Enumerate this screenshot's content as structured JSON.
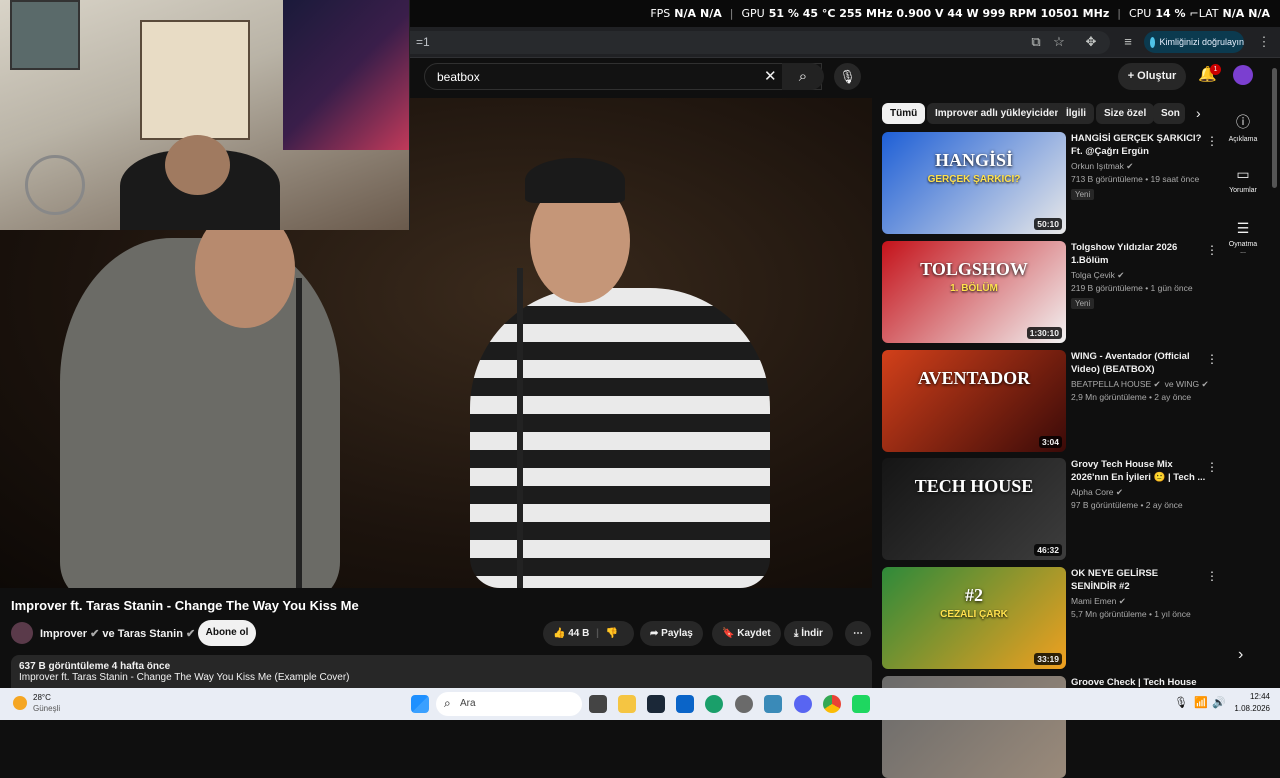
{
  "osd": {
    "fps_label": "FPS",
    "fps_val1": "N/A",
    "fps_val2": "N/A",
    "gpu_label": "GPU",
    "gpu_vals": "51 %  45 °C  255 MHz  0.900 V  44 W  999 RPM  10501 MHz",
    "cpu_label": "CPU",
    "cpu_vals": "14 %",
    "lat_label": "LAT",
    "lat_val1": "N/A",
    "lat_val2": "N/A"
  },
  "browser": {
    "url_fragment": "=1",
    "verify_label": "Kimliğinizi doğrulayın"
  },
  "header": {
    "search_value": "beatbox",
    "create_label": "Oluştur",
    "bell_badge": "1"
  },
  "video": {
    "title": "Improver ft. Taras Stanin - Change The Way You Kiss Me",
    "channel": "Improver",
    "channel_joiner": "ve Taras Stanin",
    "subscribe_label": "Abone ol",
    "like_count": "44 B",
    "share_label": "Paylaş",
    "save_label": "Kaydet",
    "download_label": "İndir",
    "views_line": "637 B görüntüleme  4 hafta önce",
    "desc_line": "Improver ft. Taras Stanin - Change The Way You Kiss Me (Example Cover)"
  },
  "chips": [
    "Tümü",
    "Improver adlı yükleyiciden",
    "İlgili",
    "Size özel",
    "Son"
  ],
  "side_actions": [
    {
      "icon": "info-icon",
      "label": "Açıklama"
    },
    {
      "icon": "comments-icon",
      "label": "Yorumlar"
    },
    {
      "icon": "playlist-icon",
      "label": "Oynatma ..."
    }
  ],
  "recommendations": [
    {
      "title": "HANGİSİ GERÇEK ŞARKICI? Ft. @Çağrı Ergün",
      "channel": "Orkun Işıtmak",
      "meta": "713 B görüntüleme • 19 saat önce",
      "badge": "Yeni",
      "duration": "50:10",
      "thumb_text": "HANGİSİ",
      "thumb_sub": "GERÇEK ŞARKICI?",
      "color1": "#1e5fd6",
      "color2": "#e8e8e8"
    },
    {
      "title": "Tolgshow Yıldızlar 2026 1.Bölüm",
      "channel": "Tolga Çevik",
      "meta": "219 B görüntüleme • 1 gün önce",
      "badge": "Yeni",
      "duration": "1:30:10",
      "thumb_text": "TOLGSHOW",
      "thumb_sub": "1. BÖLÜM",
      "color1": "#c4121a",
      "color2": "#f2f2f2"
    },
    {
      "title": "WING - Aventador (Official Video) (BEATBOX)",
      "channel": "BEATPELLA HOUSE",
      "channel2": "ve WING",
      "meta": "2,9 Mn görüntüleme • 2 ay önce",
      "badge": "",
      "duration": "3:04",
      "thumb_text": "AVENTADOR",
      "thumb_sub": "",
      "color1": "#d2401a",
      "color2": "#3a0a08"
    },
    {
      "title": "Grovy Tech House Mix 2026'nın En İyileri 🙂 | Tech ...",
      "channel": "Alpha Core",
      "meta": "97 B görüntüleme • 2 ay önce",
      "badge": "",
      "duration": "46:32",
      "thumb_text": "TECH HOUSE",
      "thumb_sub": "",
      "color1": "#151515",
      "color2": "#3d3d3d"
    },
    {
      "title": "OK NEYE GELİRSE SENİNDİR #2",
      "channel": "Mami Emen",
      "meta": "5,7 Mn görüntüleme • 1 yıl önce",
      "badge": "",
      "duration": "33:19",
      "thumb_text": "#2",
      "thumb_sub": "CEZALI ÇARK",
      "color1": "#2e8a3a",
      "color2": "#f0a020"
    },
    {
      "title": "Groove Check | Tech House",
      "channel": "",
      "meta": "",
      "badge": "",
      "duration": "",
      "thumb_text": "",
      "thumb_sub": "",
      "color1": "#6a6a6a",
      "color2": "#9a8a7a"
    }
  ],
  "taskbar": {
    "weather_temp": "28°C",
    "weather_desc": "Güneşli",
    "search_placeholder": "Ara",
    "time": "12:44",
    "date": "1.08.2026"
  }
}
